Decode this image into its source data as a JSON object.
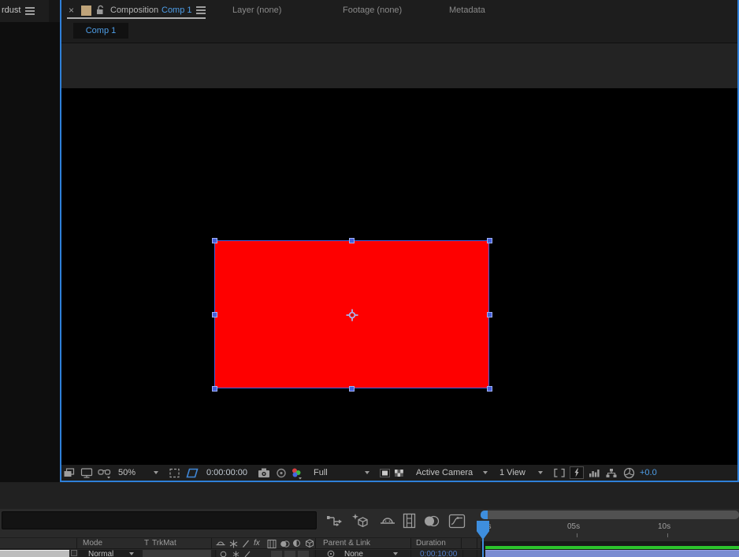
{
  "left_panel": {
    "title": "rdust"
  },
  "comp_panel": {
    "tab_group": {
      "close": "×",
      "panel_label": "Composition",
      "doc_name": "Comp 1",
      "tab_layer": "Layer (none)",
      "tab_footage": "Footage (none)",
      "tab_metadata": "Metadata"
    },
    "viewer_tab": "Comp 1",
    "toolbar": {
      "magnification": "50%",
      "timecode": "0:00:00:00",
      "resolution": "Full",
      "view": "Active Camera",
      "layout": "1 View",
      "exposure": "+0.0"
    }
  },
  "timeline_panel": {
    "ruler": {
      "t0": "0s",
      "t5": "05s",
      "t10": "10s"
    },
    "columns": {
      "mode": "Mode",
      "t": "T",
      "trkmat": "TrkMat",
      "fx": "fx",
      "parent": "Parent & Link",
      "duration": "Duration"
    },
    "layer_row": {
      "mode": "Normal",
      "parent": "None",
      "duration": "0:00:10:00"
    }
  },
  "colors": {
    "accent_blue": "#3E8EDE",
    "text_blue": "#4E9EE8",
    "solid_red": "#FE0000",
    "selection_blue": "#4560DC",
    "cache_green": "#2CC42C",
    "layer_bar_blue": "#7A8CD2"
  }
}
